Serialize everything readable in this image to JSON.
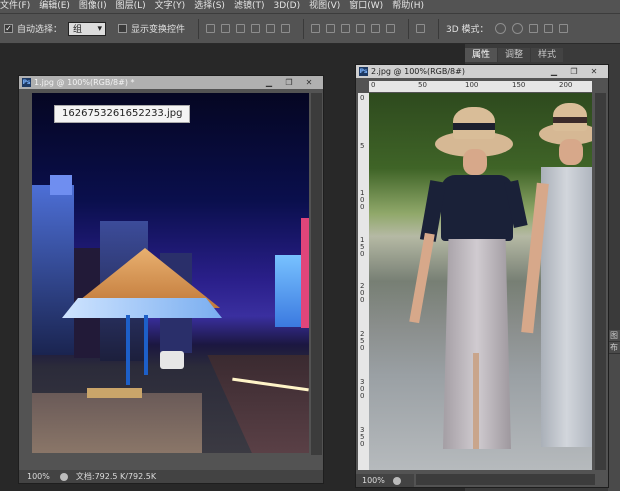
{
  "menu": [
    "文件(F)",
    "编辑(E)",
    "图像(I)",
    "图层(L)",
    "文字(Y)",
    "选择(S)",
    "滤镜(T)",
    "3D(D)",
    "视图(V)",
    "窗口(W)",
    "帮助(H)"
  ],
  "options": {
    "auto_select_label": "自动选择：",
    "auto_select_value": "组",
    "show_transform_label": "显示变换控件",
    "mode_3d_label": "3D 模式："
  },
  "panel": {
    "tabs": [
      "属性",
      "调整",
      "样式"
    ],
    "side_buttons": [
      "图",
      "布"
    ]
  },
  "doc1": {
    "title": "1.jpg @ 100%(RGB/8#) *",
    "tooltip": "1626753261652233.jpg",
    "zoom": "100%",
    "doc_info": "文档:792.5 K/792.5K"
  },
  "doc2": {
    "title": "2.jpg @ 100%(RGB/8#)",
    "zoom": "100%",
    "ruler_h": [
      "0",
      "50",
      "100",
      "150",
      "200"
    ],
    "ruler_v": [
      "0",
      "5",
      "1 0 0",
      "1 5 0",
      "2 0 0",
      "2 5 0",
      "3 0 0",
      "3 5 0"
    ]
  },
  "colors": {
    "menubar": "#535353",
    "workspace": "#282828",
    "titlebar_active": "#cfcfcf"
  }
}
